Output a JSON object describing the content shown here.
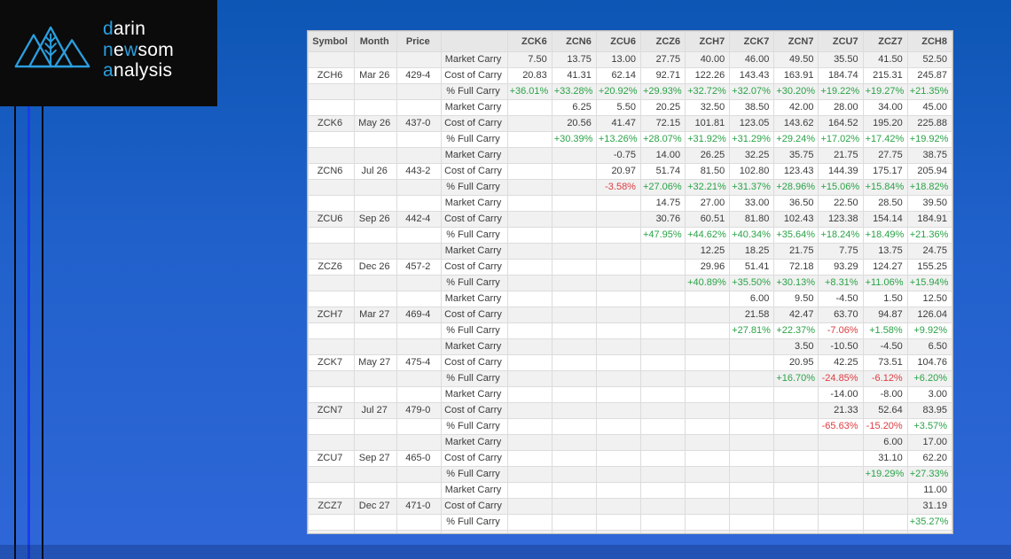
{
  "logo": {
    "lines": [
      [
        {
          "t": "d",
          "accent": true
        },
        {
          "t": "arin",
          "accent": false
        }
      ],
      [
        {
          "t": "n",
          "accent": true
        },
        {
          "t": "e",
          "accent": false
        },
        {
          "t": "w",
          "accent": true
        },
        {
          "t": "som",
          "accent": false
        }
      ],
      [
        {
          "t": "a",
          "accent": true
        },
        {
          "t": "nalysis",
          "accent": false
        }
      ]
    ],
    "mark_icon": "mountains-wheat-icon"
  },
  "colors": {
    "accent_blue": "#2b9fe0",
    "decorative_line_blue": "#1b3bee",
    "positive_green": "#2aa347",
    "negative_red": "#dd3c41",
    "background_top": "#0d56b4",
    "background_bottom": "#2f67d8"
  },
  "chart_data": {
    "type": "table",
    "title": "",
    "columns": [
      "Symbol",
      "Month",
      "Price",
      "",
      "ZCK6",
      "ZCN6",
      "ZCU6",
      "ZCZ6",
      "ZCH7",
      "ZCK7",
      "ZCN7",
      "ZCU7",
      "ZCZ7",
      "ZCH8"
    ],
    "row_labels": [
      "Market Carry",
      "Cost of Carry",
      "% Full Carry"
    ],
    "partial_row_label": "Market Carry",
    "groups": [
      {
        "symbol": "ZCH6",
        "month": "Mar 26",
        "price": "429-4",
        "market_carry": [
          "7.50",
          "13.75",
          "13.00",
          "27.75",
          "40.00",
          "46.00",
          "49.50",
          "35.50",
          "41.50",
          "52.50"
        ],
        "cost_of_carry": [
          "20.83",
          "41.31",
          "62.14",
          "92.71",
          "122.26",
          "143.43",
          "163.91",
          "184.74",
          "215.31",
          "245.87"
        ],
        "pct_full_carry": [
          "+36.01%",
          "+33.28%",
          "+20.92%",
          "+29.93%",
          "+32.72%",
          "+32.07%",
          "+30.20%",
          "+19.22%",
          "+19.27%",
          "+21.35%"
        ]
      },
      {
        "symbol": "ZCK6",
        "month": "May 26",
        "price": "437-0",
        "market_carry": [
          "",
          "6.25",
          "5.50",
          "20.25",
          "32.50",
          "38.50",
          "42.00",
          "28.00",
          "34.00",
          "45.00"
        ],
        "cost_of_carry": [
          "",
          "20.56",
          "41.47",
          "72.15",
          "101.81",
          "123.05",
          "143.62",
          "164.52",
          "195.20",
          "225.88"
        ],
        "pct_full_carry": [
          "",
          "+30.39%",
          "+13.26%",
          "+28.07%",
          "+31.92%",
          "+31.29%",
          "+29.24%",
          "+17.02%",
          "+17.42%",
          "+19.92%"
        ]
      },
      {
        "symbol": "ZCN6",
        "month": "Jul 26",
        "price": "443-2",
        "market_carry": [
          "",
          "",
          "-0.75",
          "14.00",
          "26.25",
          "32.25",
          "35.75",
          "21.75",
          "27.75",
          "38.75"
        ],
        "cost_of_carry": [
          "",
          "",
          "20.97",
          "51.74",
          "81.50",
          "102.80",
          "123.43",
          "144.39",
          "175.17",
          "205.94"
        ],
        "pct_full_carry": [
          "",
          "",
          "-3.58%",
          "+27.06%",
          "+32.21%",
          "+31.37%",
          "+28.96%",
          "+15.06%",
          "+15.84%",
          "+18.82%"
        ]
      },
      {
        "symbol": "ZCU6",
        "month": "Sep 26",
        "price": "442-4",
        "market_carry": [
          "",
          "",
          "",
          "14.75",
          "27.00",
          "33.00",
          "36.50",
          "22.50",
          "28.50",
          "39.50"
        ],
        "cost_of_carry": [
          "",
          "",
          "",
          "30.76",
          "60.51",
          "81.80",
          "102.43",
          "123.38",
          "154.14",
          "184.91"
        ],
        "pct_full_carry": [
          "",
          "",
          "",
          "+47.95%",
          "+44.62%",
          "+40.34%",
          "+35.64%",
          "+18.24%",
          "+18.49%",
          "+21.36%"
        ]
      },
      {
        "symbol": "ZCZ6",
        "month": "Dec 26",
        "price": "457-2",
        "market_carry": [
          "",
          "",
          "",
          "",
          "12.25",
          "18.25",
          "21.75",
          "7.75",
          "13.75",
          "24.75"
        ],
        "cost_of_carry": [
          "",
          "",
          "",
          "",
          "29.96",
          "51.41",
          "72.18",
          "93.29",
          "124.27",
          "155.25"
        ],
        "pct_full_carry": [
          "",
          "",
          "",
          "",
          "+40.89%",
          "+35.50%",
          "+30.13%",
          "+8.31%",
          "+11.06%",
          "+15.94%"
        ]
      },
      {
        "symbol": "ZCH7",
        "month": "Mar 27",
        "price": "469-4",
        "market_carry": [
          "",
          "",
          "",
          "",
          "",
          "6.00",
          "9.50",
          "-4.50",
          "1.50",
          "12.50"
        ],
        "cost_of_carry": [
          "",
          "",
          "",
          "",
          "",
          "21.58",
          "42.47",
          "63.70",
          "94.87",
          "126.04"
        ],
        "pct_full_carry": [
          "",
          "",
          "",
          "",
          "",
          "+27.81%",
          "+22.37%",
          "-7.06%",
          "+1.58%",
          "+9.92%"
        ]
      },
      {
        "symbol": "ZCK7",
        "month": "May 27",
        "price": "475-4",
        "market_carry": [
          "",
          "",
          "",
          "",
          "",
          "",
          "3.50",
          "-10.50",
          "-4.50",
          "6.50"
        ],
        "cost_of_carry": [
          "",
          "",
          "",
          "",
          "",
          "",
          "20.95",
          "42.25",
          "73.51",
          "104.76"
        ],
        "pct_full_carry": [
          "",
          "",
          "",
          "",
          "",
          "",
          "+16.70%",
          "-24.85%",
          "-6.12%",
          "+6.20%"
        ]
      },
      {
        "symbol": "ZCN7",
        "month": "Jul 27",
        "price": "479-0",
        "market_carry": [
          "",
          "",
          "",
          "",
          "",
          "",
          "",
          "-14.00",
          "-8.00",
          "3.00"
        ],
        "cost_of_carry": [
          "",
          "",
          "",
          "",
          "",
          "",
          "",
          "21.33",
          "52.64",
          "83.95"
        ],
        "pct_full_carry": [
          "",
          "",
          "",
          "",
          "",
          "",
          "",
          "-65.63%",
          "-15.20%",
          "+3.57%"
        ]
      },
      {
        "symbol": "ZCU7",
        "month": "Sep 27",
        "price": "465-0",
        "market_carry": [
          "",
          "",
          "",
          "",
          "",
          "",
          "",
          "",
          "6.00",
          "17.00"
        ],
        "cost_of_carry": [
          "",
          "",
          "",
          "",
          "",
          "",
          "",
          "",
          "31.10",
          "62.20"
        ],
        "pct_full_carry": [
          "",
          "",
          "",
          "",
          "",
          "",
          "",
          "",
          "+19.29%",
          "+27.33%"
        ]
      },
      {
        "symbol": "ZCZ7",
        "month": "Dec 27",
        "price": "471-0",
        "market_carry": [
          "",
          "",
          "",
          "",
          "",
          "",
          "",
          "",
          "",
          "11.00"
        ],
        "cost_of_carry": [
          "",
          "",
          "",
          "",
          "",
          "",
          "",
          "",
          "",
          "31.19"
        ],
        "pct_full_carry": [
          "",
          "",
          "",
          "",
          "",
          "",
          "",
          "",
          "",
          "+35.27%"
        ]
      }
    ]
  }
}
